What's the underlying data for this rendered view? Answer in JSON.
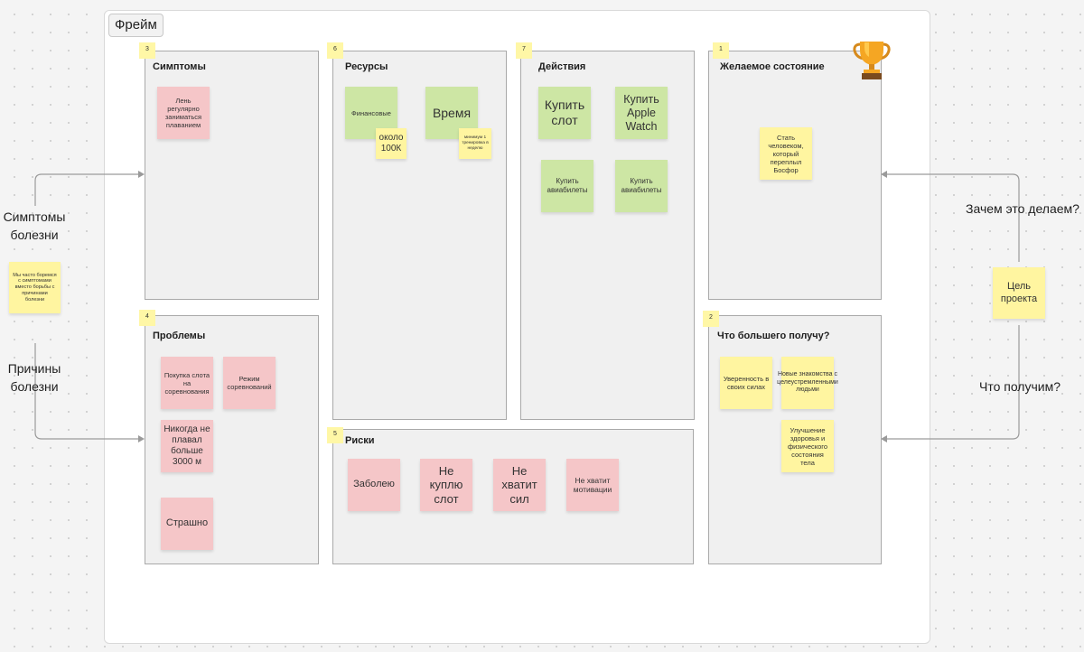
{
  "frame": {
    "label": "Фрейм"
  },
  "sections": {
    "symptoms": {
      "num": "3",
      "title": "Симптомы"
    },
    "resources": {
      "num": "6",
      "title": "Ресурсы"
    },
    "actions": {
      "num": "7",
      "title": "Действия"
    },
    "desired": {
      "num": "1",
      "title": "Желаемое состояние"
    },
    "problems": {
      "num": "4",
      "title": "Проблемы"
    },
    "risks": {
      "num": "5",
      "title": "Риски"
    },
    "bigger": {
      "num": "2",
      "title": "Что большего получу?"
    }
  },
  "notes": {
    "symptoms_1": "Лень регулярно заниматься плаванием",
    "res_fin": "Финансовые",
    "res_time": "Время",
    "res_100k": "около 100К",
    "res_train": "минимум 1 тренировка в неделю",
    "act_slot": "Купить слот",
    "act_watch": "Купить Apple Watch",
    "act_tickets_1": "Купить авиабилеты",
    "act_tickets_2": "Купить авиабилеты",
    "desired_1": "Стать человеком, который переплыл Босфор",
    "prob_slot": "Покупка слота на соревнования",
    "prob_mode": "Режим соревнований",
    "prob_3000": "Никогда не плавал больше 3000 м",
    "prob_scary": "Страшно",
    "risk_sick": "Заболею",
    "risk_noslot": "Не куплю слот",
    "risk_nostrength": "Не хватит сил",
    "risk_nomotivation": "Не хватит мотивации",
    "big_confidence": "Уверенность в своих силах",
    "big_people": "Новые знакомства с целеустремленными людьми",
    "big_health": "Улучшение здоровья и физического состояния тела"
  },
  "left": {
    "symptoms_label": "Симптомы болезни",
    "causes_label": "Причины болезни",
    "note": "Мы часто боремся с симптомами вместо борьбы с причинами болезни"
  },
  "right": {
    "why_label": "Зачем это делаем?",
    "get_label": "Что получим?",
    "goal_note": "Цель проекта"
  },
  "icons": {
    "trophy": "trophy-icon"
  },
  "colors": {
    "pink": "#f5c6c8",
    "green": "#cde6a4",
    "yellow": "#fff5a0"
  }
}
